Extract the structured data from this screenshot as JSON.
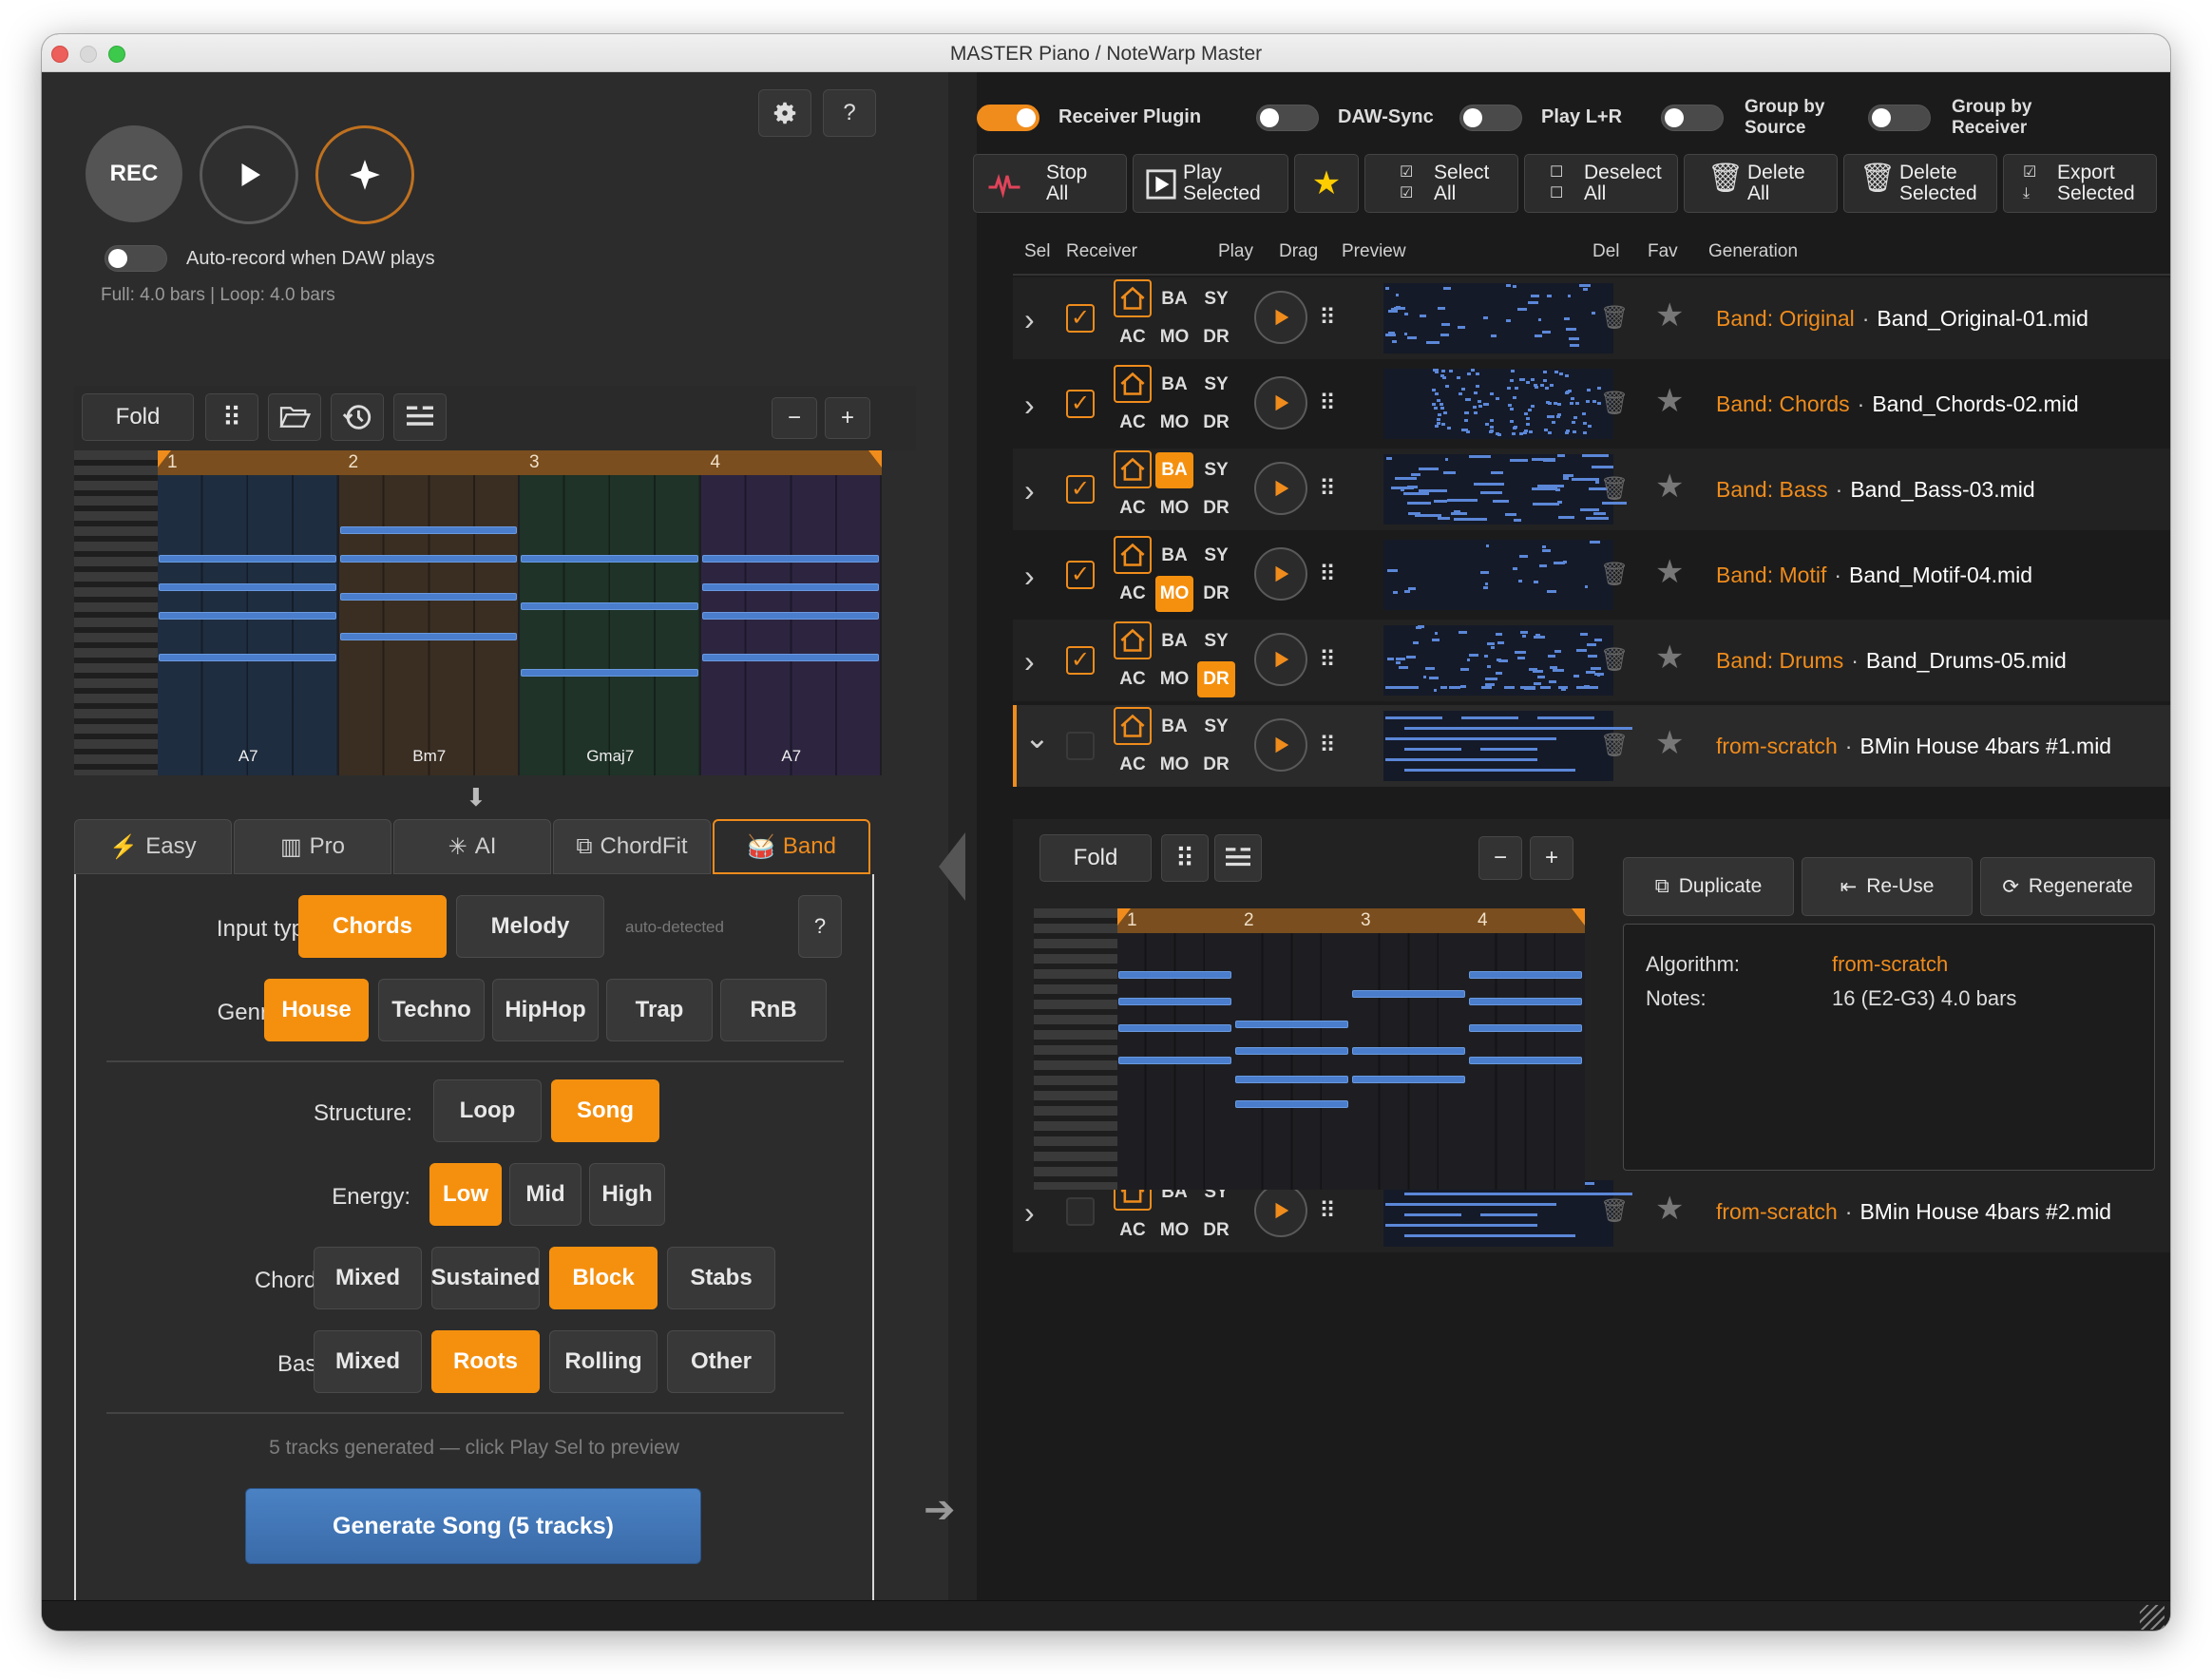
{
  "window": {
    "title": "MASTER Piano / NoteWarp Master"
  },
  "colors": {
    "accent": "#f08c1c",
    "primary_button": "#3f72b0",
    "note": "#4a7ecc"
  },
  "left": {
    "icons": {
      "settings": "gear-icon",
      "help": "?"
    },
    "rec_label": "REC",
    "auto_record_label": "Auto-record when DAW plays",
    "info": "Full: 4.0 bars  |  Loop: 4.0 bars",
    "toolbar": {
      "fold": "Fold",
      "minus": "−",
      "plus": "+"
    },
    "bars": [
      "1",
      "2",
      "3",
      "4"
    ],
    "chords": [
      "A7",
      "Bm7",
      "Gmaj7",
      "A7"
    ],
    "tabs": [
      {
        "label": "Easy",
        "icon": "bolt-icon"
      },
      {
        "label": "Pro",
        "icon": "sliders-icon"
      },
      {
        "label": "AI",
        "icon": "sparkle-icon"
      },
      {
        "label": "ChordFit",
        "icon": "puzzle-icon"
      },
      {
        "label": "Band",
        "icon": "drum-icon"
      }
    ],
    "form": {
      "input_type_label": "Input type:",
      "input_options": [
        "Chords",
        "Melody"
      ],
      "auto_detected": "auto-detected",
      "help": "?",
      "genre_label": "Genre:",
      "genres": [
        "House",
        "Techno",
        "HipHop",
        "Trap",
        "RnB"
      ],
      "structure_label": "Structure:",
      "structures": [
        "Loop",
        "Song"
      ],
      "energy_label": "Energy:",
      "energies": [
        "Low",
        "Mid",
        "High"
      ],
      "chords_label": "Chords:",
      "chord_styles": [
        "Mixed",
        "Sustained",
        "Block",
        "Stabs"
      ],
      "bass_label": "Bass:",
      "bass_styles": [
        "Mixed",
        "Roots",
        "Rolling",
        "Other"
      ],
      "status": "5 tracks generated — click Play Sel to preview",
      "generate_button": "Generate Song (5 tracks)"
    }
  },
  "right": {
    "toggles": [
      {
        "label": "Receiver Plugin",
        "on": true
      },
      {
        "label": "DAW-Sync",
        "on": false
      },
      {
        "label": "Play L+R",
        "on": false
      },
      {
        "label": "Group by Source",
        "on": false
      },
      {
        "label": "Group by Receiver",
        "on": false
      }
    ],
    "group_source_l1": "Group by",
    "group_source_l2": "Source",
    "group_receiver_l1": "Group by",
    "group_receiver_l2": "Receiver",
    "actions": {
      "stop_1": "Stop",
      "stop_2": "All",
      "play_1": "Play",
      "play_2": "Selected",
      "select_1": "Select",
      "select_2": "All",
      "deselect_1": "Deselect",
      "deselect_2": "All",
      "delete_1": "Delete",
      "delete_2": "All",
      "delsel_1": "Delete",
      "delsel_2": "Selected",
      "export_1": "Export",
      "export_2": "Selected"
    },
    "columns": {
      "sel": "Sel",
      "receiver": "Receiver",
      "play": "Play",
      "drag": "Drag",
      "preview": "Preview",
      "del": "Del",
      "fav": "Fav",
      "generation": "Generation"
    },
    "receiver_labels": {
      "ba": "BA",
      "sy": "SY",
      "ac": "AC",
      "mo": "MO",
      "dr": "DR"
    },
    "rows": [
      {
        "source": "Band: Original",
        "sep": "·",
        "file": "Band_Original-01.mid",
        "checked": true
      },
      {
        "source": "Band: Chords",
        "sep": "·",
        "file": "Band_Chords-02.mid",
        "checked": true
      },
      {
        "source": "Band: Bass",
        "sep": "·",
        "file": "Band_Bass-03.mid",
        "checked": true
      },
      {
        "source": "Band: Motif",
        "sep": "·",
        "file": "Band_Motif-04.mid",
        "checked": true
      },
      {
        "source": "Band: Drums",
        "sep": "·",
        "file": "Band_Drums-05.mid",
        "checked": true
      },
      {
        "source": "from-scratch",
        "sep": "·",
        "file": "BMin House 4bars #1.mid",
        "checked": false
      },
      {
        "source": "from-scratch",
        "sep": "·",
        "file": "BMin House 4bars #2.mid",
        "checked": false
      }
    ],
    "detail": {
      "fold": "Fold",
      "minus": "−",
      "plus": "+",
      "bars": [
        "1",
        "2",
        "3",
        "4"
      ],
      "duplicate": "Duplicate",
      "reuse": "Re-Use",
      "regenerate": "Regenerate",
      "algorithm_label": "Algorithm:",
      "algorithm_value": "from-scratch",
      "notes_label": "Notes:",
      "notes_value": "16 (E2-G3)  4.0 bars"
    }
  }
}
